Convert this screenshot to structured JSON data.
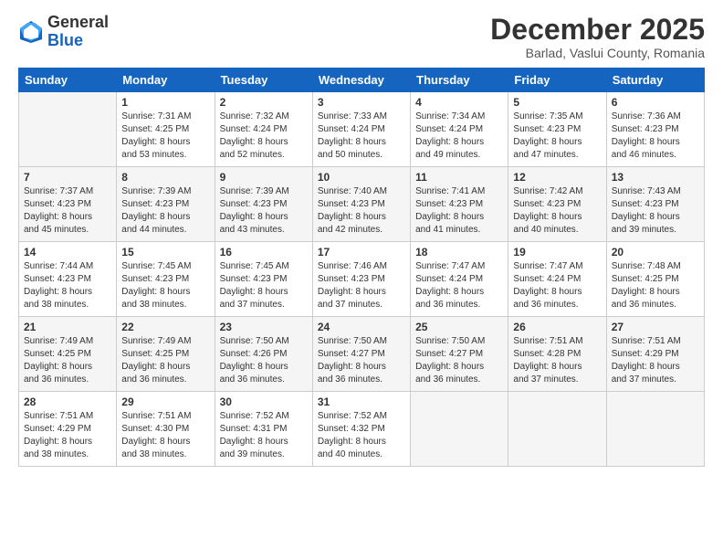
{
  "logo": {
    "general": "General",
    "blue": "Blue"
  },
  "title": "December 2025",
  "subtitle": "Barlad, Vaslui County, Romania",
  "weekdays": [
    "Sunday",
    "Monday",
    "Tuesday",
    "Wednesday",
    "Thursday",
    "Friday",
    "Saturday"
  ],
  "weeks": [
    [
      {
        "day": "",
        "info": ""
      },
      {
        "day": "1",
        "info": "Sunrise: 7:31 AM\nSunset: 4:25 PM\nDaylight: 8 hours\nand 53 minutes."
      },
      {
        "day": "2",
        "info": "Sunrise: 7:32 AM\nSunset: 4:24 PM\nDaylight: 8 hours\nand 52 minutes."
      },
      {
        "day": "3",
        "info": "Sunrise: 7:33 AM\nSunset: 4:24 PM\nDaylight: 8 hours\nand 50 minutes."
      },
      {
        "day": "4",
        "info": "Sunrise: 7:34 AM\nSunset: 4:24 PM\nDaylight: 8 hours\nand 49 minutes."
      },
      {
        "day": "5",
        "info": "Sunrise: 7:35 AM\nSunset: 4:23 PM\nDaylight: 8 hours\nand 47 minutes."
      },
      {
        "day": "6",
        "info": "Sunrise: 7:36 AM\nSunset: 4:23 PM\nDaylight: 8 hours\nand 46 minutes."
      }
    ],
    [
      {
        "day": "7",
        "info": "Sunrise: 7:37 AM\nSunset: 4:23 PM\nDaylight: 8 hours\nand 45 minutes."
      },
      {
        "day": "8",
        "info": "Sunrise: 7:39 AM\nSunset: 4:23 PM\nDaylight: 8 hours\nand 44 minutes."
      },
      {
        "day": "9",
        "info": "Sunrise: 7:39 AM\nSunset: 4:23 PM\nDaylight: 8 hours\nand 43 minutes."
      },
      {
        "day": "10",
        "info": "Sunrise: 7:40 AM\nSunset: 4:23 PM\nDaylight: 8 hours\nand 42 minutes."
      },
      {
        "day": "11",
        "info": "Sunrise: 7:41 AM\nSunset: 4:23 PM\nDaylight: 8 hours\nand 41 minutes."
      },
      {
        "day": "12",
        "info": "Sunrise: 7:42 AM\nSunset: 4:23 PM\nDaylight: 8 hours\nand 40 minutes."
      },
      {
        "day": "13",
        "info": "Sunrise: 7:43 AM\nSunset: 4:23 PM\nDaylight: 8 hours\nand 39 minutes."
      }
    ],
    [
      {
        "day": "14",
        "info": "Sunrise: 7:44 AM\nSunset: 4:23 PM\nDaylight: 8 hours\nand 38 minutes."
      },
      {
        "day": "15",
        "info": "Sunrise: 7:45 AM\nSunset: 4:23 PM\nDaylight: 8 hours\nand 38 minutes."
      },
      {
        "day": "16",
        "info": "Sunrise: 7:45 AM\nSunset: 4:23 PM\nDaylight: 8 hours\nand 37 minutes."
      },
      {
        "day": "17",
        "info": "Sunrise: 7:46 AM\nSunset: 4:23 PM\nDaylight: 8 hours\nand 37 minutes."
      },
      {
        "day": "18",
        "info": "Sunrise: 7:47 AM\nSunset: 4:24 PM\nDaylight: 8 hours\nand 36 minutes."
      },
      {
        "day": "19",
        "info": "Sunrise: 7:47 AM\nSunset: 4:24 PM\nDaylight: 8 hours\nand 36 minutes."
      },
      {
        "day": "20",
        "info": "Sunrise: 7:48 AM\nSunset: 4:25 PM\nDaylight: 8 hours\nand 36 minutes."
      }
    ],
    [
      {
        "day": "21",
        "info": "Sunrise: 7:49 AM\nSunset: 4:25 PM\nDaylight: 8 hours\nand 36 minutes."
      },
      {
        "day": "22",
        "info": "Sunrise: 7:49 AM\nSunset: 4:25 PM\nDaylight: 8 hours\nand 36 minutes."
      },
      {
        "day": "23",
        "info": "Sunrise: 7:50 AM\nSunset: 4:26 PM\nDaylight: 8 hours\nand 36 minutes."
      },
      {
        "day": "24",
        "info": "Sunrise: 7:50 AM\nSunset: 4:27 PM\nDaylight: 8 hours\nand 36 minutes."
      },
      {
        "day": "25",
        "info": "Sunrise: 7:50 AM\nSunset: 4:27 PM\nDaylight: 8 hours\nand 36 minutes."
      },
      {
        "day": "26",
        "info": "Sunrise: 7:51 AM\nSunset: 4:28 PM\nDaylight: 8 hours\nand 37 minutes."
      },
      {
        "day": "27",
        "info": "Sunrise: 7:51 AM\nSunset: 4:29 PM\nDaylight: 8 hours\nand 37 minutes."
      }
    ],
    [
      {
        "day": "28",
        "info": "Sunrise: 7:51 AM\nSunset: 4:29 PM\nDaylight: 8 hours\nand 38 minutes."
      },
      {
        "day": "29",
        "info": "Sunrise: 7:51 AM\nSunset: 4:30 PM\nDaylight: 8 hours\nand 38 minutes."
      },
      {
        "day": "30",
        "info": "Sunrise: 7:52 AM\nSunset: 4:31 PM\nDaylight: 8 hours\nand 39 minutes."
      },
      {
        "day": "31",
        "info": "Sunrise: 7:52 AM\nSunset: 4:32 PM\nDaylight: 8 hours\nand 40 minutes."
      },
      {
        "day": "",
        "info": ""
      },
      {
        "day": "",
        "info": ""
      },
      {
        "day": "",
        "info": ""
      }
    ]
  ]
}
